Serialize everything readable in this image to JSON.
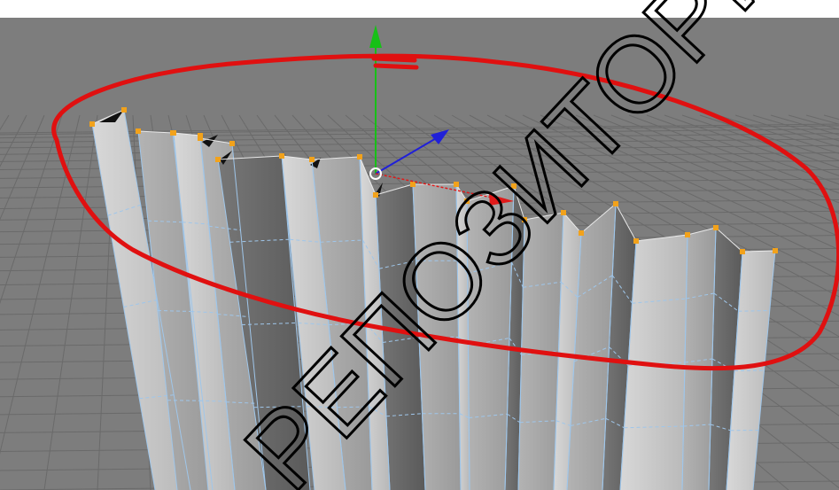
{
  "scene": {
    "background_color": "#7d7d7d",
    "grid_color": "#6a6a6a",
    "panel_light": "#cfcfcf",
    "panel_mid": "#a9a9a9",
    "panel_dark": "#3c3c3c",
    "edge_color": "#9fc6ea",
    "vertex_color": "#f2a21b",
    "selection_ring_color": "#e01010"
  },
  "gizmo": {
    "axes": [
      {
        "name": "y-axis",
        "color": "#17c017"
      },
      {
        "name": "z-axis",
        "color": "#2020d8"
      },
      {
        "name": "x-axis",
        "color": "#e01a1a"
      }
    ]
  },
  "watermark": {
    "text": "РЕПОЗИТОРИЙ БГЭУ",
    "color": "#000000"
  }
}
